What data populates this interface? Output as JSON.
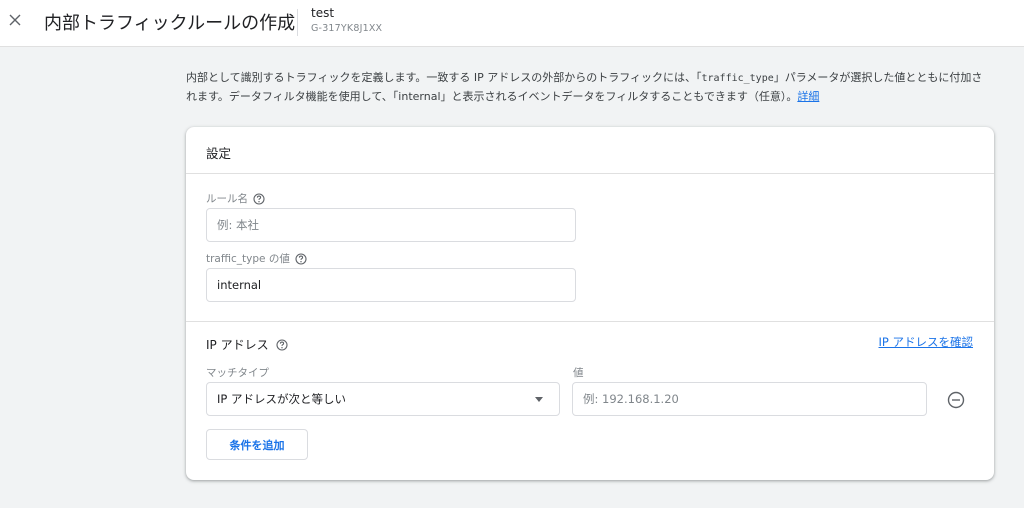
{
  "header": {
    "title": "内部トラフィックルールの作成",
    "property_name": "test",
    "property_id": "G-317YK8J1XX"
  },
  "description": {
    "part1": "内部として識別するトラフィックを定義します。一致する IP アドレスの外部からのトラフィックには、「",
    "param": "traffic_type",
    "part2": "」パラメータが選択した値とともに付加されます。データフィルタ機能を使用して、「internal」と表示されるイベントデータをフィルタすることもできます（任意）。",
    "link": "詳細"
  },
  "settings": {
    "title": "設定",
    "rule_name": {
      "label": "ルール名",
      "placeholder": "例: 本社",
      "value": ""
    },
    "traffic_type": {
      "label": "traffic_type の値",
      "value": "internal"
    },
    "ip_section": {
      "title": "IP アドレス",
      "verify_link": "IP アドレスを確認",
      "match_type_label": "マッチタイプ",
      "match_type_value": "IP アドレスが次と等しい",
      "value_label": "値",
      "value_placeholder": "例: 192.168.1.20"
    },
    "add_condition": "条件を追加"
  }
}
